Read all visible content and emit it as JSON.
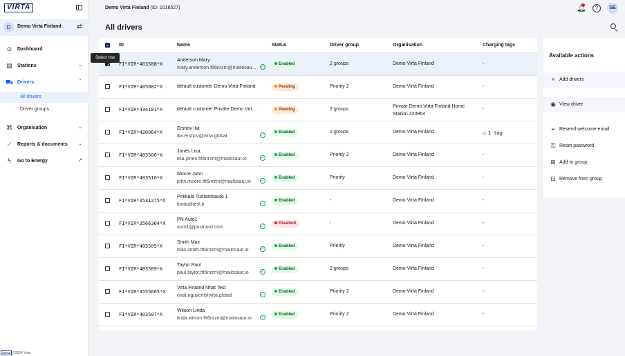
{
  "brand": {
    "logo_text": "VIRTA",
    "footer_text": "©2024 Virta"
  },
  "org_switch": {
    "initial": "D",
    "name": "Demo Virta Finland"
  },
  "nav": [
    {
      "id": "dashboard",
      "label": "Dashboard",
      "icon": "dashboard-icon",
      "chevron": ""
    },
    {
      "id": "stations",
      "label": "Stations",
      "icon": "station-icon",
      "chevron": "⌄"
    },
    {
      "id": "drivers",
      "label": "Drivers",
      "icon": "drivers-icon",
      "chevron": "⌃"
    },
    {
      "id": "organisation",
      "label": "Organisation",
      "icon": "organisation-icon",
      "chevron": "⌄"
    },
    {
      "id": "reports",
      "label": "Reports & documents",
      "icon": "chart-icon",
      "chevron": "⌄"
    },
    {
      "id": "energy",
      "label": "Go to Energy",
      "icon": "energy-icon",
      "chevron": "↗"
    }
  ],
  "subnav": [
    {
      "label": "All drivers",
      "active": true
    },
    {
      "label": "Driver groups",
      "active": false
    }
  ],
  "header": {
    "company": "Demo Virta Finland",
    "company_id": "(ID: 1016527)",
    "user_initials": "SE"
  },
  "page": {
    "title": "All drivers"
  },
  "table": {
    "columns": [
      "ID",
      "Name",
      "Status",
      "Driver group",
      "Organisation",
      "Charging tags"
    ],
    "rows": [
      {
        "id": "FI*VIR*403508*X",
        "name": "Anderson Mary",
        "email": "mary.anderson.ftt6nrzm@mailosau...",
        "verified": true,
        "status": "Enabled",
        "group": "2 groups",
        "org": "Demo Virta Finland",
        "tags": "-"
      },
      {
        "id": "FI*VIR*405082*X",
        "name": "default customer Demo Virta Finland",
        "email": "",
        "verified": false,
        "status": "Pending",
        "group": "Priority 2",
        "org": "Demo Virta Finland",
        "tags": "-"
      },
      {
        "id": "FI*VIR*434181*X",
        "name": "default customer Private Demo Virta Fi...",
        "email": "",
        "verified": false,
        "status": "Pending",
        "group": "2 groups",
        "org": "Private Demo Virta Finland Home Station 420964",
        "tags": "-"
      },
      {
        "id": "FI*VIR*420964*X",
        "name": "Ershov Ilia",
        "email": "ilia.ershov@virta.global",
        "verified": true,
        "status": "Enabled",
        "group": "2 groups",
        "org": "Demo Virta Finland",
        "tags": "1 tag"
      },
      {
        "id": "FI*VIR*403506*X",
        "name": "Jones Lisa",
        "email": "lisa.jones.ftt6nrzm@mailosaur.io",
        "verified": true,
        "status": "Enabled",
        "group": "Priority 2",
        "org": "Demo Virta Finland",
        "tags": "-"
      },
      {
        "id": "FI*VIR*403510*X",
        "name": "Moore John",
        "email": "john.moore.ftt6nrzm@mailosaur.io",
        "verified": true,
        "status": "Enabled",
        "group": "Priority",
        "org": "Demo Virta Finland",
        "tags": "-"
      },
      {
        "id": "FI*VIR*3531275*X",
        "name": "Pirkkala Tuotantoauto 1",
        "email": "tuota@test.fi",
        "verified": true,
        "status": "Enabled",
        "group": "-",
        "org": "Demo Virta Finland",
        "tags": "-"
      },
      {
        "id": "FI*VIR*3566364*X",
        "name": "PN Auto1",
        "email": "auto1@postnord.com",
        "verified": true,
        "status": "Disabled",
        "group": "-",
        "org": "Demo Virta Finland",
        "tags": "-"
      },
      {
        "id": "FI*VIR*403505*X",
        "name": "Smith Max",
        "email": "max.smith.ftt6nrzm@mailosaur.io",
        "verified": true,
        "status": "Enabled",
        "group": "Priority",
        "org": "Demo Virta Finland",
        "tags": "-"
      },
      {
        "id": "FI*VIR*403509*X",
        "name": "Taylor Paul",
        "email": "paul.taylor.ftt6nrzm@mailosaur.io",
        "verified": true,
        "status": "Enabled",
        "group": "2 groups",
        "org": "Demo Virta Finland",
        "tags": "-"
      },
      {
        "id": "FI*VIR*3555665*X",
        "name": "Virta Finland Nhat Test",
        "email": "nhat.nguyen@virta.global",
        "verified": true,
        "status": "Enabled",
        "group": "Priority 2",
        "org": "Demo Virta Finland",
        "tags": "-"
      },
      {
        "id": "FI*VIR*403507*X",
        "name": "Wilson Linda",
        "email": "linda.wilson.ftt6nrzm@mailosaur.io",
        "verified": true,
        "status": "Enabled",
        "group": "Priority 2",
        "org": "Demo Virta Finland",
        "tags": "-"
      }
    ]
  },
  "tooltip": {
    "text": "Select row"
  },
  "actions": {
    "title": "Available actions",
    "items": [
      {
        "label": "Add drivers",
        "icon": "plus-icon",
        "glyph": "+"
      },
      {
        "label": "View driver",
        "icon": "eye-icon",
        "glyph": "◉"
      },
      {
        "label": "Resend welcome email",
        "icon": "send-icon",
        "glyph": "➢"
      },
      {
        "label": "Reset password",
        "icon": "key-icon",
        "glyph": "⚿"
      },
      {
        "label": "Add to group",
        "icon": "add-group-icon",
        "glyph": "⊞"
      },
      {
        "label": "Remove from group",
        "icon": "remove-group-icon",
        "glyph": "⊟"
      }
    ]
  }
}
